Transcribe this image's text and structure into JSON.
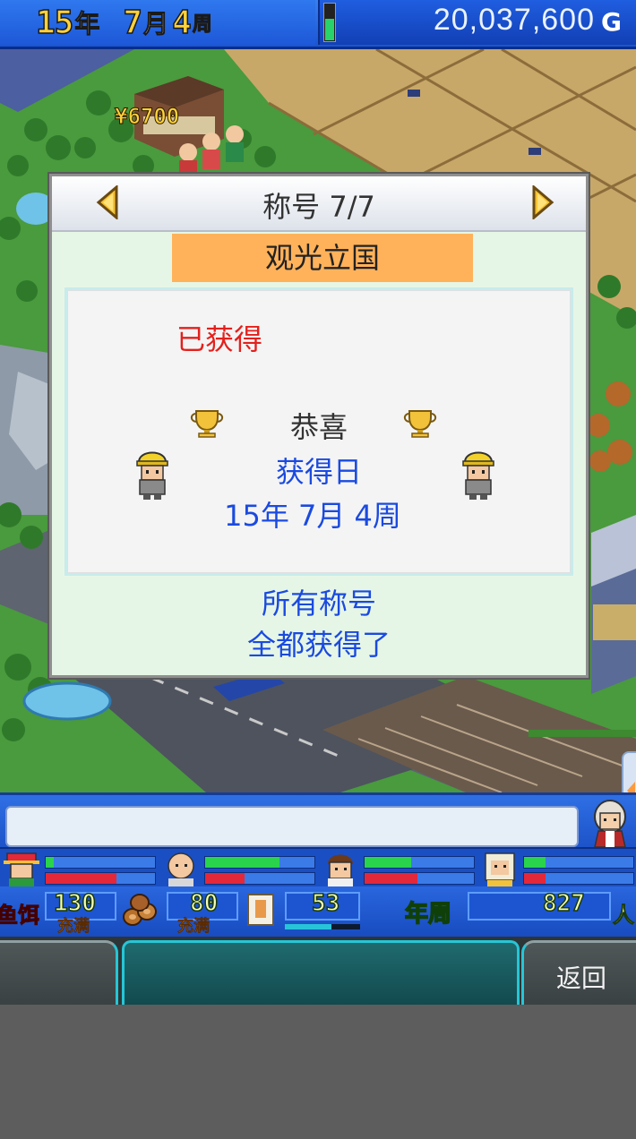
{
  "header": {
    "year": "15",
    "year_unit": "年",
    "month": "7",
    "month_unit": "月",
    "week": "4",
    "week_unit": "周",
    "money": "20,037,600",
    "money_unit": "G",
    "battery_level": 0.6
  },
  "map": {
    "price_tag": "¥6700"
  },
  "dialog": {
    "header_title": "称号 7/7",
    "title_name": "观光立国",
    "status": "已获得",
    "congrats": "恭喜",
    "date_label": "获得日",
    "date_value": "15年 7月 4周",
    "footer_line1": "所有称号",
    "footer_line2": "全都获得了"
  },
  "staff": [
    {
      "name": "staff-1",
      "green": 0.07,
      "red": 0.65
    },
    {
      "name": "staff-2",
      "green": 0.68,
      "red": 0.36
    },
    {
      "name": "staff-3",
      "green": 0.43,
      "red": 0.48
    },
    {
      "name": "staff-4",
      "green": 0.2,
      "red": 0.2
    }
  ],
  "resources": {
    "red_label": "鱼饵",
    "item1_value": "130",
    "item1_sub": "充满",
    "item2_value": "80",
    "item2_sub": "充满",
    "item3_value": "53",
    "period_label": "年周",
    "population": "827",
    "population_unit": "人"
  },
  "footer": {
    "back_label": "返回"
  },
  "colors": {
    "accent_blue": "#1a55d0",
    "title_banner": "#ffb25a",
    "obtained_red": "#e4201c",
    "info_blue": "#1a4ae0",
    "bottom_teal": "#25c6d6"
  }
}
